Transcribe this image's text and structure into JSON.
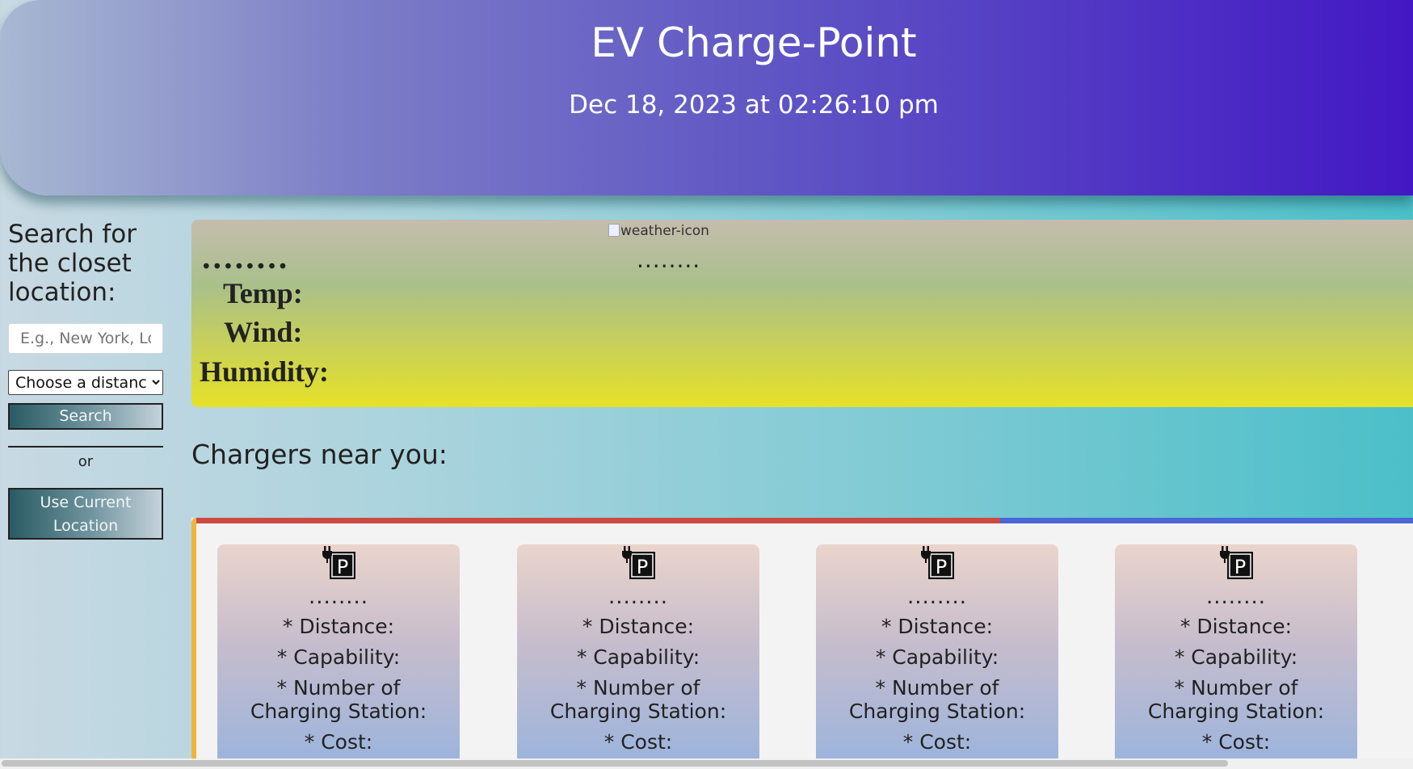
{
  "header": {
    "title": "EV Charge-Point",
    "datetime": "Dec 18, 2023 at 02:26:10 pm"
  },
  "sidebar": {
    "heading": "Search for the closet location:",
    "search_placeholder": "E.g., New York, London",
    "distance_select": {
      "selected": "Choose a distance"
    },
    "search_button": "Search",
    "or_text": "or",
    "location_button": "Use Current Location"
  },
  "weather": {
    "icon_alt": "weather-icon",
    "city_placeholder": "........",
    "city_placeholder_small": "........",
    "temp_label": "Temp:",
    "wind_label": "Wind:",
    "humidity_label": "Humidity:"
  },
  "chargers": {
    "heading": "Chargers near you:",
    "cards": [
      {
        "name": "........",
        "distance": "* Distance:",
        "capability": "* Capability:",
        "stations": "* Number of Charging Station:",
        "cost": "* Cost:",
        "icon": "ev-charger-parking-icon"
      },
      {
        "name": "........",
        "distance": "* Distance:",
        "capability": "* Capability:",
        "stations": "* Number of Charging Station:",
        "cost": "* Cost:",
        "icon": "ev-charger-parking-icon"
      },
      {
        "name": "........",
        "distance": "* Distance:",
        "capability": "* Capability:",
        "stations": "* Number of Charging Station:",
        "cost": "* Cost:",
        "icon": "ev-charger-parking-icon"
      },
      {
        "name": "........",
        "distance": "* Distance:",
        "capability": "* Capability:",
        "stations": "* Number of Charging Station:",
        "cost": "* Cost:",
        "icon": "ev-charger-parking-icon"
      }
    ]
  },
  "colors": {
    "header_start": "#a8b8d2",
    "header_end": "#4318c4",
    "weather_top": "#c5bcae",
    "weather_bottom": "#e6e128",
    "chargers_border_red": "#cc4a42",
    "chargers_border_blue": "#4b66d8",
    "chargers_border_yellow": "#f0b43a"
  }
}
